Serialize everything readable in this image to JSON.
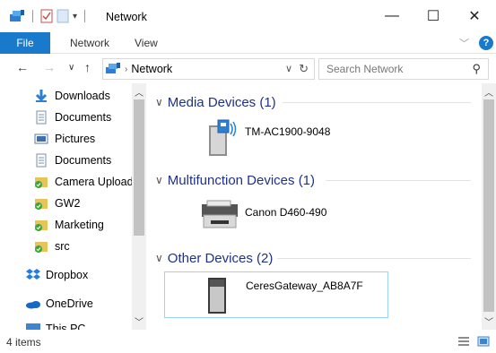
{
  "window": {
    "title": "Network",
    "controls": {
      "minimize": "—",
      "maximize": "☐",
      "close": "✕"
    }
  },
  "ribbon": {
    "tabs": [
      "File",
      "Network",
      "View"
    ],
    "help": "?"
  },
  "address": {
    "breadcrumb": "Network",
    "search_placeholder": "Search Network"
  },
  "nav": {
    "items": [
      {
        "label": "Downloads",
        "icon": "download-icon",
        "pinned": true
      },
      {
        "label": "Documents",
        "icon": "documents-icon",
        "pinned": true
      },
      {
        "label": "Pictures",
        "icon": "pictures-icon",
        "pinned": true
      },
      {
        "label": "Documents",
        "icon": "documents-icon",
        "pinned": true
      },
      {
        "label": "Camera Uploads",
        "icon": "synced-folder-icon",
        "pinned": false
      },
      {
        "label": "GW2",
        "icon": "synced-folder-icon",
        "pinned": false
      },
      {
        "label": "Marketing",
        "icon": "synced-folder-icon",
        "pinned": false
      },
      {
        "label": "src",
        "icon": "synced-folder-icon",
        "pinned": false
      },
      {
        "label": "Dropbox",
        "icon": "dropbox-icon",
        "pinned": false
      },
      {
        "label": "OneDrive",
        "icon": "onedrive-icon",
        "pinned": false
      },
      {
        "label": "This PC",
        "icon": "this-pc-icon",
        "pinned": false
      }
    ]
  },
  "groups": [
    {
      "header": "Media Devices (1)",
      "devices": [
        {
          "label": "TM-AC1900-9048",
          "icon": "media-device-icon"
        }
      ]
    },
    {
      "header": "Multifunction Devices (1)",
      "devices": [
        {
          "label": "Canon D460-490",
          "icon": "printer-icon"
        }
      ]
    },
    {
      "header": "Other Devices (2)",
      "devices": [
        {
          "label": "CeresGateway_AB8A7F",
          "icon": "gateway-device-icon"
        }
      ]
    }
  ],
  "status": {
    "item_count": "4 items"
  },
  "colors": {
    "accent": "#1979ca",
    "group_header": "#1e3287",
    "selection_border": "#99d1ff"
  }
}
